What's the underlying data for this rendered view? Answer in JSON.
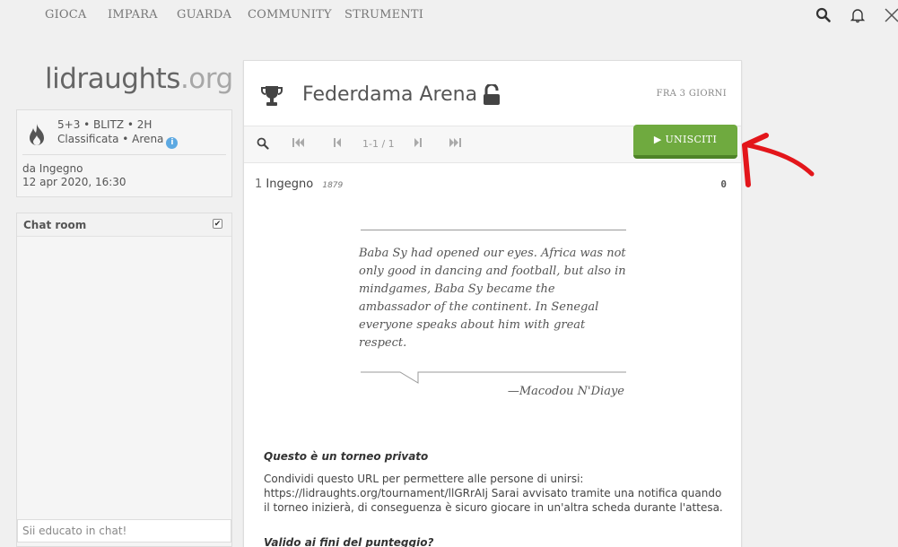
{
  "nav": {
    "items": [
      "GIOCA",
      "IMPARA",
      "GUARDA",
      "COMMUNITY",
      "STRUMENTI"
    ]
  },
  "icons": {
    "search": "search-icon",
    "bell": "bell-icon",
    "swords": "crossed-swords-icon",
    "trophy": "trophy-icon",
    "lock": "unlocked-padlock-icon",
    "fire": "fire-icon",
    "info": "info-icon"
  },
  "logo": {
    "name": "lidraughts",
    "tld": ".org"
  },
  "tour_info": {
    "line1": "5+3 • BLITZ • 2H",
    "line2": "Classificata • Arena",
    "by": "da Ingegno",
    "date": "12 apr 2020, 16:30"
  },
  "chat": {
    "title": "Chat room",
    "placeholder": "Sii educato in chat!"
  },
  "main": {
    "title": "Federdama Arena",
    "starts": "FRA 3 GIORNI",
    "pager": "1-1 / 1",
    "join_label": "UNISCITI",
    "standings": [
      {
        "rank": "1",
        "name": "Ingegno",
        "rating": "1879",
        "score": "0"
      }
    ],
    "quote": "Baba Sy had opened our eyes. Africa was not only good in dancing and football, but also in mindgames, Baba Sy became the ambassador of the continent. In Senegal everyone speaks about him with great respect.",
    "author": "—Macodou N'Diaye",
    "private_title": "Questo è un torneo privato",
    "private_text": "Condividi questo URL per permettere alle persone di unirsi: https://lidraughts.org/tournament/llGRrAIj Sarai avvisato tramite una notifica quando il torneo inizierà, di conseguenza è sicuro giocare in un'altra scheda durante l'attesa.",
    "valid_title": "Valido ai fini del punteggio?"
  },
  "colors": {
    "join_green": "#6faa3f",
    "annotation_red": "#e3161b",
    "info_blue": "#5da9e2"
  }
}
